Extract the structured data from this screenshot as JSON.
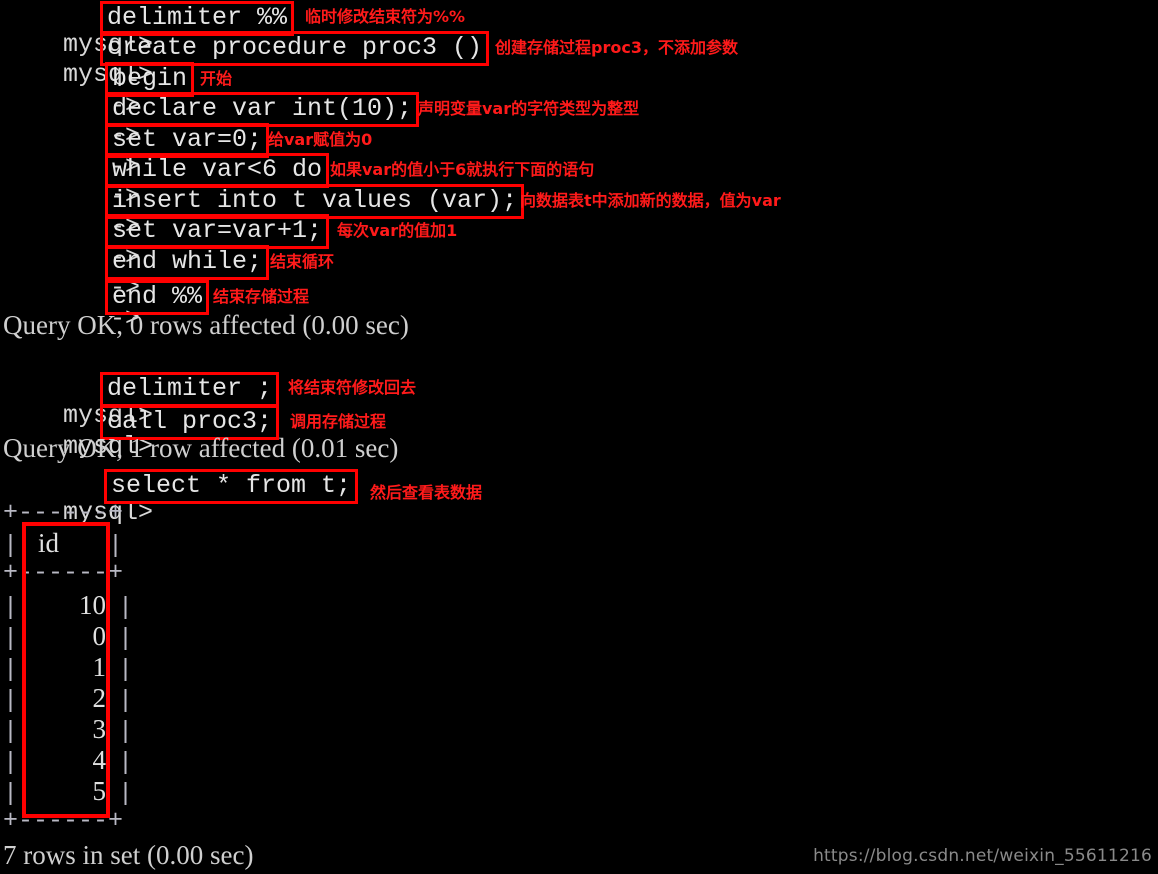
{
  "terminal": {
    "prompt": "mysql>",
    "continuation": "->",
    "colors": {
      "background": "#000000",
      "text": "#cfcfcf",
      "highlight_box": "#ff0000",
      "annotation": "#ff1a1a",
      "table_border": "#b9b9c4",
      "watermark": "#8a8a8a"
    }
  },
  "session": [
    {
      "kind": "prompt",
      "lead": "mysql>",
      "statement": "delimiter %%",
      "note": "临时修改结束符为%%"
    },
    {
      "kind": "prompt",
      "lead": "mysql>",
      "statement": "create procedure proc3 ()",
      "note": "创建存储过程proc3，不添加参数"
    },
    {
      "kind": "continuation",
      "lead": "->",
      "statement": "begin",
      "note": "开始"
    },
    {
      "kind": "continuation",
      "lead": "->",
      "statement": "declare var int(10);",
      "note": "声明变量var的字符类型为整型"
    },
    {
      "kind": "continuation",
      "lead": "->",
      "statement": "set var=0;",
      "note": "给var赋值为0"
    },
    {
      "kind": "continuation",
      "lead": "->",
      "statement": "while var<6 do",
      "note": "如果var的值小于6就执行下面的语句"
    },
    {
      "kind": "continuation",
      "lead": "->",
      "statement": "insert into t values (var);",
      "note": "向数据表t中添加新的数据，值为var"
    },
    {
      "kind": "continuation",
      "lead": "->",
      "statement": "set var=var+1;",
      "note": "每次var的值加1"
    },
    {
      "kind": "continuation",
      "lead": "->",
      "statement": "end while;",
      "note": "结束循环"
    },
    {
      "kind": "continuation",
      "lead": "->",
      "statement": "end %%",
      "note": "结束存储过程"
    },
    {
      "kind": "output",
      "text": "Query OK, 0 rows affected (0.00 sec)"
    },
    {
      "kind": "blank",
      "text": ""
    },
    {
      "kind": "prompt",
      "lead": "mysql>",
      "statement": "delimiter ;",
      "note": "将结束符修改回去"
    },
    {
      "kind": "prompt",
      "lead": "mysql>",
      "statement": "call proc3;",
      "note": "调用存储过程"
    },
    {
      "kind": "output",
      "text": "Query OK, 1 row affected (0.01 sec)"
    },
    {
      "kind": "prompt",
      "lead": "mysql>",
      "statement": "select * from t;",
      "note": "然后查看表数据"
    }
  ],
  "result_table": {
    "rule": "+------+",
    "columns": [
      "id"
    ],
    "rows": [
      [
        "10"
      ],
      [
        "0"
      ],
      [
        "1"
      ],
      [
        "2"
      ],
      [
        "3"
      ],
      [
        "4"
      ],
      [
        "5"
      ]
    ],
    "footer": "7 rows in set (0.00 sec)"
  },
  "watermark": {
    "text": "https://blog.csdn.net/weixin_55611216"
  }
}
